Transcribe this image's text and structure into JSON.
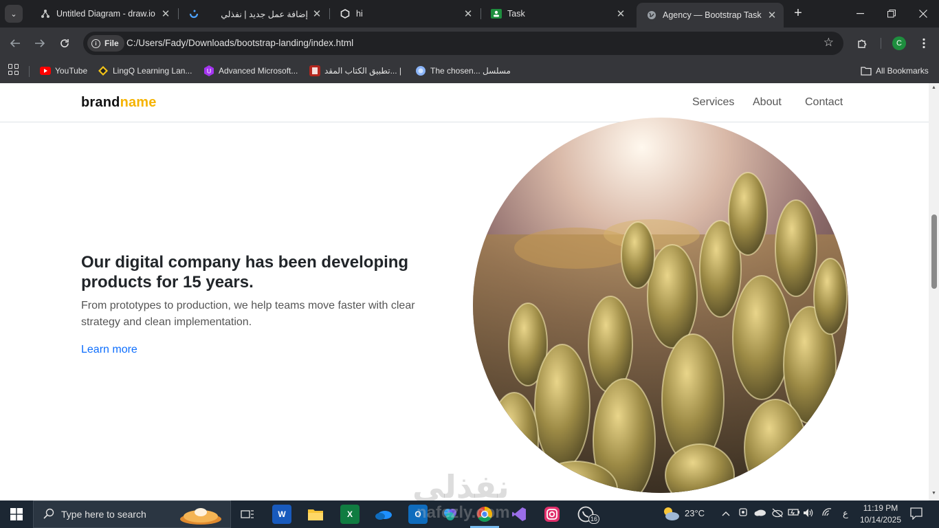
{
  "browser": {
    "tabs": [
      {
        "title": "Untitled Diagram - draw.io",
        "icon": "drawio-icon"
      },
      {
        "title": "إضافة عمل جديد | نفذلي",
        "icon": "nafezly-icon"
      },
      {
        "title": "hi",
        "icon": "github-icon"
      },
      {
        "title": "Task",
        "icon": "classroom-icon"
      },
      {
        "title": "Agency — Bootstrap Task",
        "icon": "globe-icon",
        "active": true
      }
    ],
    "address": {
      "scheme_label": "File",
      "url": "C:/Users/Fady/Downloads/bootstrap-landing/index.html"
    },
    "profile_initial": "C",
    "bookmarks": [
      {
        "label": "YouTube",
        "icon": "youtube-icon"
      },
      {
        "label": "LingQ Learning Lan...",
        "icon": "lingq-icon"
      },
      {
        "label": "Advanced Microsoft...",
        "icon": "udemy-icon"
      },
      {
        "label": "تطبيق الكتاب المقد... |",
        "icon": "bible-icon"
      },
      {
        "label": "The chosen... مسلسل",
        "icon": "chosen-icon"
      }
    ],
    "all_bookmarks_label": "All Bookmarks"
  },
  "page": {
    "brand_main": "brand",
    "brand_accent": "name",
    "nav": [
      "Services",
      "About",
      "Contact"
    ],
    "hero_title": "Our digital company has been developing products for 15 years.",
    "hero_subtitle": "From prototypes to production, we help teams move faster with clear strategy and clean implementation.",
    "hero_link": "Learn more",
    "watermark": "نفذلي",
    "colors": {
      "accent": "#f5b301",
      "link": "#0d6efd"
    }
  },
  "taskbar": {
    "search_placeholder": "Type here to search",
    "weather": "23°C",
    "input_lang": "ع",
    "time": "11:19 PM",
    "date": "10/14/2025",
    "whatsapp_badge": "16",
    "watermark": "nafezly.com"
  }
}
